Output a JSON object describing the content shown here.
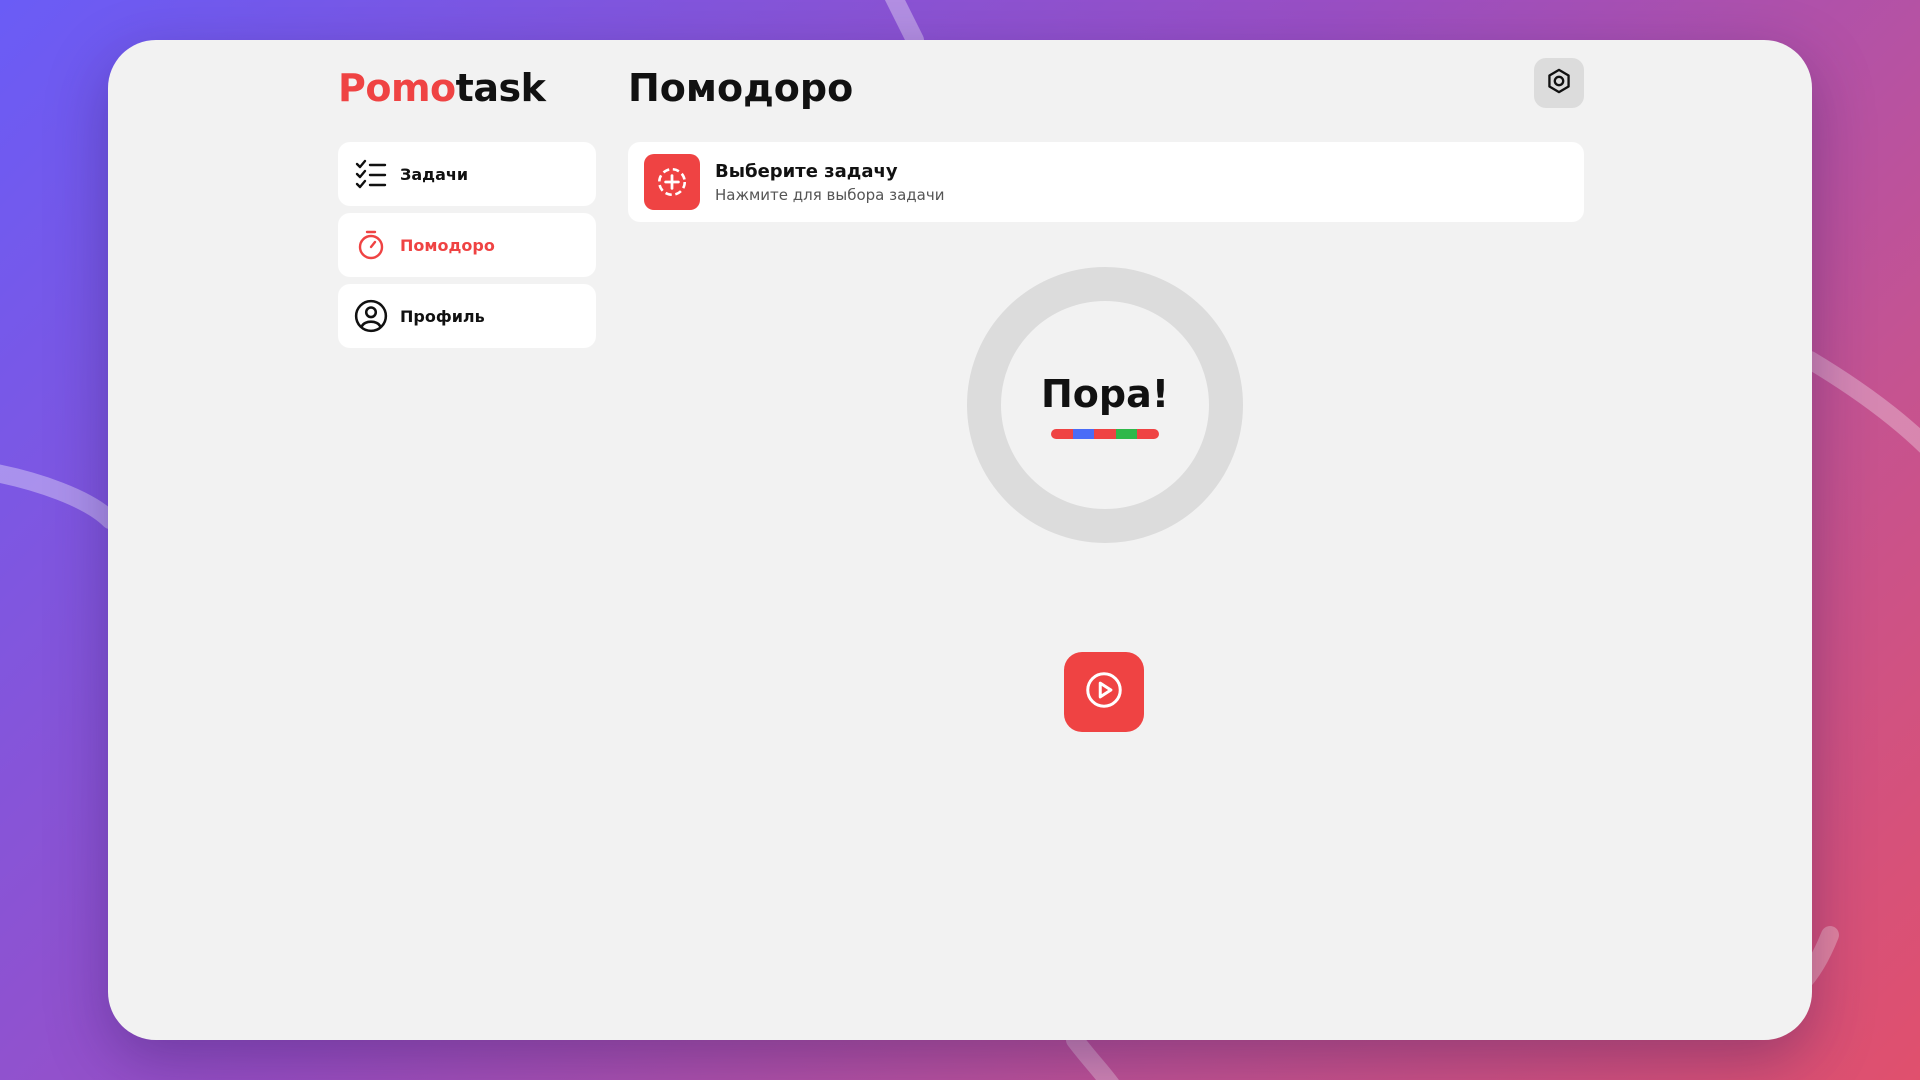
{
  "app": {
    "logo_part1": "Pomo",
    "logo_part2": "task",
    "page_title": "Помодоро"
  },
  "header": {
    "settings_icon": "gear-icon"
  },
  "sidebar": {
    "items": [
      {
        "label": "Задачи",
        "icon": "checklist-icon",
        "active": false
      },
      {
        "label": "Помодоро",
        "icon": "stopwatch-icon",
        "active": true
      },
      {
        "label": "Профиль",
        "icon": "user-circle-icon",
        "active": false
      }
    ]
  },
  "task_selector": {
    "title": "Выберите задачу",
    "subtitle": "Нажмите для выбора задачи",
    "icon": "add-task-icon"
  },
  "timer": {
    "label": "Пора!",
    "progress": 0,
    "stripe_colors": [
      "#ef4343",
      "#4a6cf7",
      "#ef4343",
      "#2fb84a",
      "#ef4343"
    ]
  },
  "controls": {
    "play_icon": "play-icon"
  },
  "colors": {
    "accent": "#ef4343",
    "background_window": "#f2f2f2",
    "ring": "#dcdcdc"
  }
}
